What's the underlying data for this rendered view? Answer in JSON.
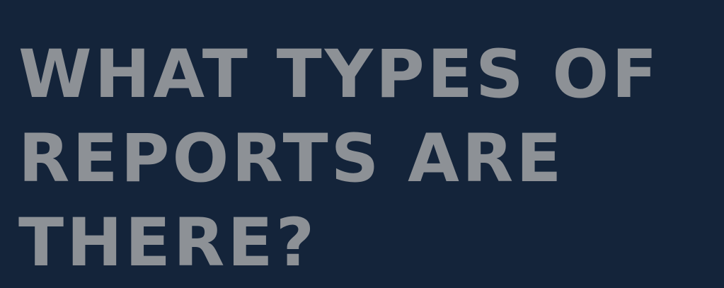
{
  "slide": {
    "title_lines": [
      "WHAT TYPES OF",
      "REPORTS ARE",
      "THERE?"
    ]
  },
  "colors": {
    "background": "#14243a",
    "text": "#8d9196"
  }
}
